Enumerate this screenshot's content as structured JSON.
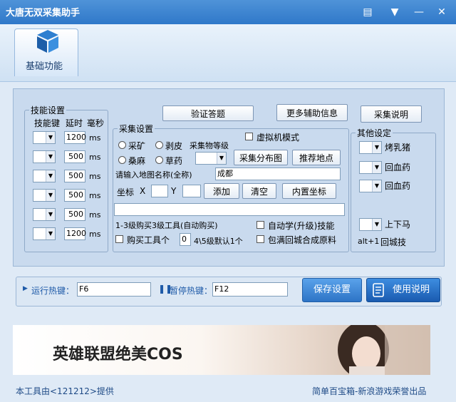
{
  "window": {
    "title": "大唐无双采集助手",
    "icons": [
      "chat-icon",
      "dropdown-icon",
      "minimize-icon",
      "close-icon"
    ]
  },
  "toolbar": {
    "tab_label": "基础功能"
  },
  "skills": {
    "legend": "技能设置",
    "headers": {
      "key": "技能键",
      "delay": "延时",
      "ms": "毫秒"
    },
    "rows": [
      {
        "key": "",
        "delay": "1200",
        "unit": "ms"
      },
      {
        "key": "",
        "delay": "500",
        "unit": "ms"
      },
      {
        "key": "",
        "delay": "500",
        "unit": "ms"
      },
      {
        "key": "",
        "delay": "500",
        "unit": "ms"
      },
      {
        "key": "",
        "delay": "500",
        "unit": "ms"
      },
      {
        "key": "",
        "delay": "1200",
        "unit": "ms"
      }
    ]
  },
  "top_buttons": {
    "verify": "验证答题",
    "more_info": "更多辅助信息",
    "gather_help": "采集说明"
  },
  "gather": {
    "legend": "采集设置",
    "radio_mine": "采矿",
    "radio_skin": "剥皮",
    "radio_hemp": "桑麻",
    "radio_herb": "草药",
    "level_label": "采集物等级",
    "vm_mode": "虚拟机模式",
    "distribution_btn": "采集分布图",
    "recommend_btn": "推荐地点",
    "map_prompt": "请输入地图名称(全称)",
    "map_value": "成都",
    "coord_label": "坐标",
    "x_label": "X",
    "y_label": "Y",
    "add_btn": "添加",
    "clear_btn": "清空",
    "builtin_btn": "内置坐标",
    "buy_info": "1-3级购买3级工具(自动购买)",
    "auto_learn": "自动学(升级)技能",
    "buy_tool": "购买工具个",
    "buy_count": "0",
    "tool_hint": "4\\5级默认1个",
    "return_city": "包满回城合成原料"
  },
  "other": {
    "legend": "其他设定",
    "roast_pig": "烤乳猪",
    "hp_potion_1": "回血药",
    "hp_potion_2": "回血药",
    "mount": "上下马",
    "alt_key": "alt+1",
    "return_skill": "回城技"
  },
  "hotkeys": {
    "run_label": "运行热键：",
    "run_value": "F6",
    "pause_label": "暂停热键：",
    "pause_value": "F12",
    "save_btn": "保存设置",
    "help_btn": "使用说明"
  },
  "banner": {
    "text": "英雄联盟绝美COS"
  },
  "footer": {
    "left": "本工具由<121212>提供",
    "right": "简单百宝箱-新浪游戏荣誉出品"
  }
}
